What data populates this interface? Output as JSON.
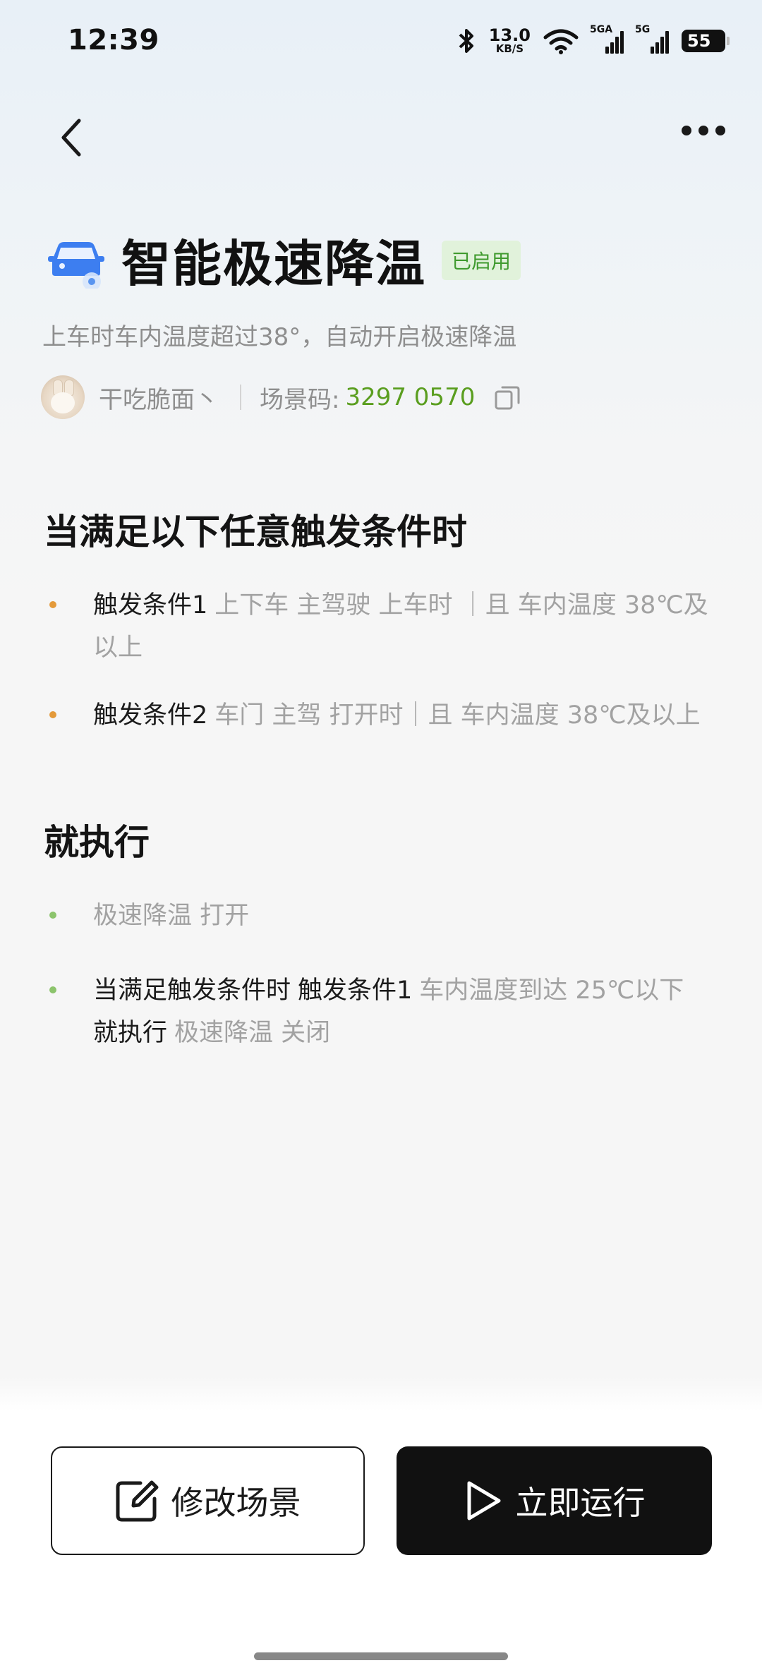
{
  "status_bar": {
    "time": "12:39",
    "net_speed_value": "13.0",
    "net_speed_unit": "KB/S",
    "sim1_label": "5GA",
    "sim2_label": "5G",
    "battery_level": "55",
    "icons": [
      "bluetooth-icon",
      "wifi-icon",
      "signal-icon",
      "battery-icon"
    ]
  },
  "nav": {
    "back_icon": "chevron-left-icon",
    "more_icon": "more-dots-icon"
  },
  "scene": {
    "title": "智能极速降温",
    "status_badge": "已启用",
    "description": "上车时车内温度超过38°，自动开启极速降温",
    "author": "干吃脆面丶",
    "code_label": "场景码:",
    "code_value": "3297 0570"
  },
  "triggers": {
    "heading": "当满足以下任意触发条件时",
    "items": [
      {
        "label": "触发条件1",
        "detail": "上下车 主驾驶 上车时 ｜且 车内温度 38℃及以上"
      },
      {
        "label": "触发条件2",
        "detail": "车门 主驾 打开时｜且 车内温度 38℃及以上"
      }
    ]
  },
  "actions": {
    "heading": "就执行",
    "items": [
      {
        "detail": "极速降温 打开"
      },
      {
        "cond_label": "当满足触发条件时",
        "cond_target": "触发条件1",
        "cond_detail": "车内温度到达 25℃以下",
        "exec_label": "就执行",
        "exec_detail": "极速降温 关闭"
      }
    ]
  },
  "buttons": {
    "edit_label": "修改场景",
    "run_label": "立即运行"
  },
  "colors": {
    "accent_green": "#5a9e1f",
    "badge_bg": "#e1f2db",
    "trigger_dot": "#e49a3a",
    "action_dot": "#8cc46c"
  }
}
